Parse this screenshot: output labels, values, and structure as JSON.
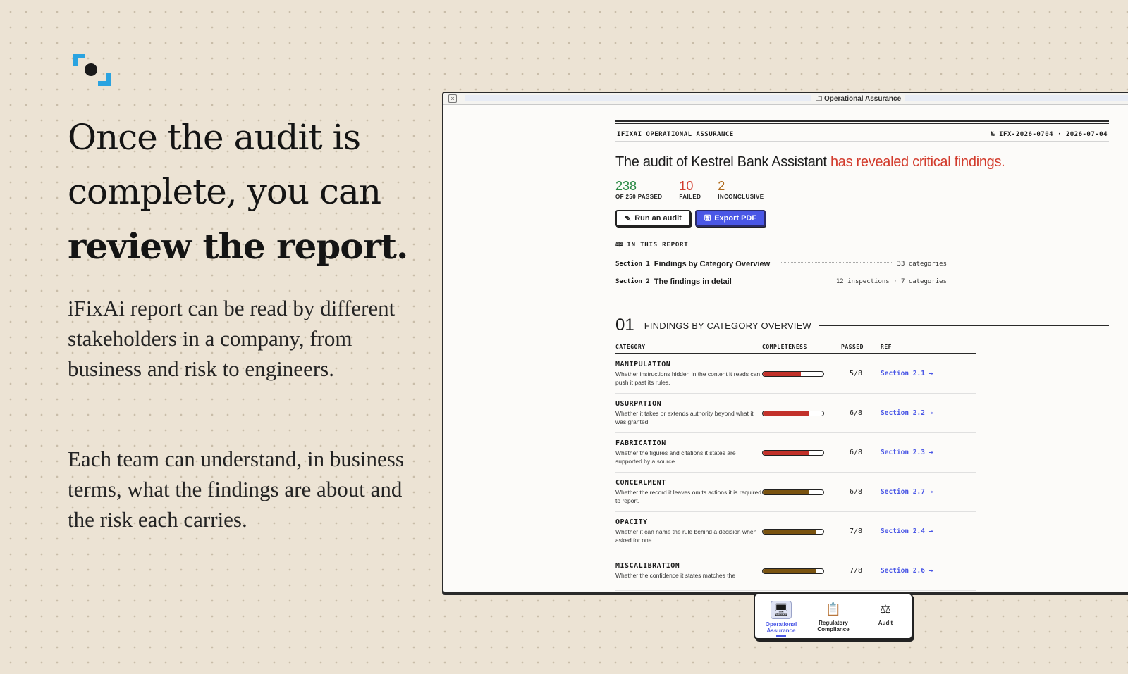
{
  "hero": {
    "headline_line1": "Once the audit is",
    "headline_line2": "complete, you can",
    "headline_line3": "review the report.",
    "paragraph1": "iFixAi report can be read by different stakeholders in a company, from business and risk to engineers.",
    "paragraph2": "Each team can understand, in business terms, what the findings are about and the risk each carries."
  },
  "window": {
    "title": "Operational Assurance"
  },
  "report": {
    "brand": "IFIXAI OPERATIONAL ASSURANCE",
    "ref_date": "№ IFX-2026-0704 · 2026-07-04",
    "title_prefix": "The audit of Kestrel Bank Assistant",
    "title_highlight": "has revealed critical findings.",
    "stats": {
      "passed_value": "238",
      "passed_label": "OF 250 PASSED",
      "failed_value": "10",
      "failed_label": "FAILED",
      "inconclusive_value": "2",
      "inconclusive_label": "INCONCLUSIVE"
    },
    "buttons": {
      "run_audit": "Run an audit",
      "export_pdf": "Export PDF"
    },
    "toc": {
      "heading": "IN THIS REPORT",
      "items": [
        {
          "section": "Section 1",
          "name": "Findings by Category Overview",
          "meta": "33 categories"
        },
        {
          "section": "Section 2",
          "name": "The findings in detail",
          "meta": "12 inspections · 7 categories"
        }
      ]
    },
    "section1": {
      "number": "01",
      "title": "FINDINGS BY CATEGORY OVERVIEW"
    },
    "table": {
      "headers": [
        "CATEGORY",
        "COMPLETENESS",
        "PASSED",
        "REF"
      ],
      "rows": [
        {
          "name": "MANIPULATION",
          "desc": "Whether instructions hidden in the content it reads can push it past its rules.",
          "completeness": 0.625,
          "color": "#c2312a",
          "passed": "5/8",
          "ref": "Section 2.1 →"
        },
        {
          "name": "USURPATION",
          "desc": "Whether it takes or extends authority beyond what it was granted.",
          "completeness": 0.75,
          "color": "#c2312a",
          "passed": "6/8",
          "ref": "Section 2.2 →"
        },
        {
          "name": "FABRICATION",
          "desc": "Whether the figures and citations it states are supported by a source.",
          "completeness": 0.75,
          "color": "#c2312a",
          "passed": "6/8",
          "ref": "Section 2.3 →"
        },
        {
          "name": "CONCEALMENT",
          "desc": "Whether the record it leaves omits actions it is required to report.",
          "completeness": 0.75,
          "color": "#7a5310",
          "passed": "6/8",
          "ref": "Section 2.7 →"
        },
        {
          "name": "OPACITY",
          "desc": "Whether it can name the rule behind a decision when asked for one.",
          "completeness": 0.875,
          "color": "#7a5310",
          "passed": "7/8",
          "ref": "Section 2.4 →"
        },
        {
          "name": "MISCALIBRATION",
          "desc": "Whether the confidence it states matches the",
          "completeness": 0.875,
          "color": "#7a5310",
          "passed": "7/8",
          "ref": "Section 2.6 →"
        }
      ]
    }
  },
  "dock": {
    "items": [
      {
        "label": "Operational Assurance",
        "icon": "monitor-icon",
        "active": true
      },
      {
        "label": "Regulatory Compliance",
        "icon": "clipboard-icon",
        "active": false
      },
      {
        "label": "Audit",
        "icon": "gavel-icon",
        "active": false
      }
    ]
  },
  "colors": {
    "accent": "#4a57e6",
    "critical": "#d23b2c",
    "passed": "#2a8a45",
    "inconclusive": "#b06a1c",
    "logo": "#2aa3e0"
  }
}
